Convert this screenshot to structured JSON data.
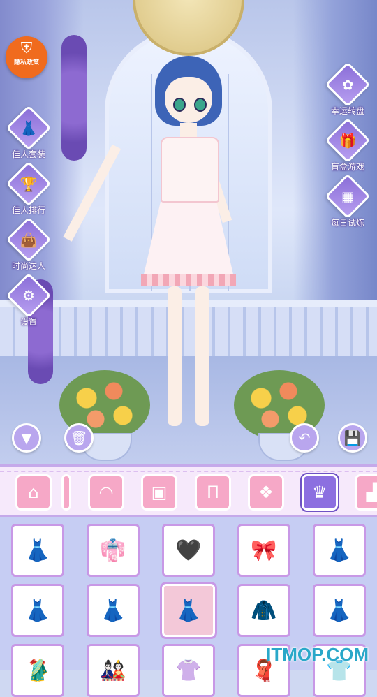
{
  "privacy": {
    "icon": "shield-doc-icon",
    "label": "隐私政策"
  },
  "left_menu": [
    {
      "name": "dress-set",
      "icon": "dress-icon",
      "glyph": "👗",
      "label": "佳人套装"
    },
    {
      "name": "ranking",
      "icon": "trophy-icon",
      "glyph": "🏆",
      "label": "佳人排行"
    },
    {
      "name": "fashion",
      "icon": "handbag-icon",
      "glyph": "👜",
      "label": "时尚达人"
    },
    {
      "name": "settings",
      "icon": "gear-icon",
      "glyph": "⚙",
      "label": "设置"
    }
  ],
  "right_menu": [
    {
      "name": "lucky-wheel",
      "icon": "wheel-icon",
      "glyph": "✿",
      "label": "幸运转盘"
    },
    {
      "name": "blind-box",
      "icon": "gift-icon",
      "glyph": "🎁",
      "label": "盲盒游戏"
    },
    {
      "name": "daily-trial",
      "icon": "calendar-icon",
      "glyph": "▦",
      "label": "每日试炼"
    }
  ],
  "controls": {
    "collapse": "▼",
    "trash": "🗑",
    "undo": "↶",
    "save": "💾"
  },
  "categories": [
    {
      "name": "home",
      "icon": "home-icon",
      "glyph": "⌂"
    },
    {
      "name": "hair",
      "icon": "hair-icon",
      "glyph": "◠"
    },
    {
      "name": "top",
      "icon": "top-icon",
      "glyph": "▣"
    },
    {
      "name": "pants",
      "icon": "pants-icon",
      "glyph": "Π"
    },
    {
      "name": "coat",
      "icon": "coat-icon",
      "glyph": "❖"
    },
    {
      "name": "dress",
      "icon": "dress-icon",
      "glyph": "♛",
      "selected": true
    },
    {
      "name": "socks",
      "icon": "socks-icon",
      "glyph": "▟"
    }
  ],
  "items": [
    {
      "glyph": "👗",
      "selected": false
    },
    {
      "glyph": "👘",
      "selected": false
    },
    {
      "glyph": "🖤",
      "selected": false
    },
    {
      "glyph": "🎀",
      "selected": false
    },
    {
      "glyph": "👗",
      "selected": false
    },
    {
      "glyph": "👗",
      "selected": false
    },
    {
      "glyph": "👗",
      "selected": false
    },
    {
      "glyph": "👗",
      "selected": true
    },
    {
      "glyph": "🧥",
      "selected": false
    },
    {
      "glyph": "👗",
      "selected": false
    },
    {
      "glyph": "🥻",
      "selected": false
    },
    {
      "glyph": "🎎",
      "selected": false
    },
    {
      "glyph": "👚",
      "selected": false
    },
    {
      "glyph": "🧣",
      "selected": false
    },
    {
      "glyph": "👕",
      "selected": false
    }
  ],
  "watermark": "ITMOP.COM",
  "colors": {
    "accent": "#8c6fe0",
    "pink": "#f6a8c7",
    "privacy": "#f06b1e"
  }
}
